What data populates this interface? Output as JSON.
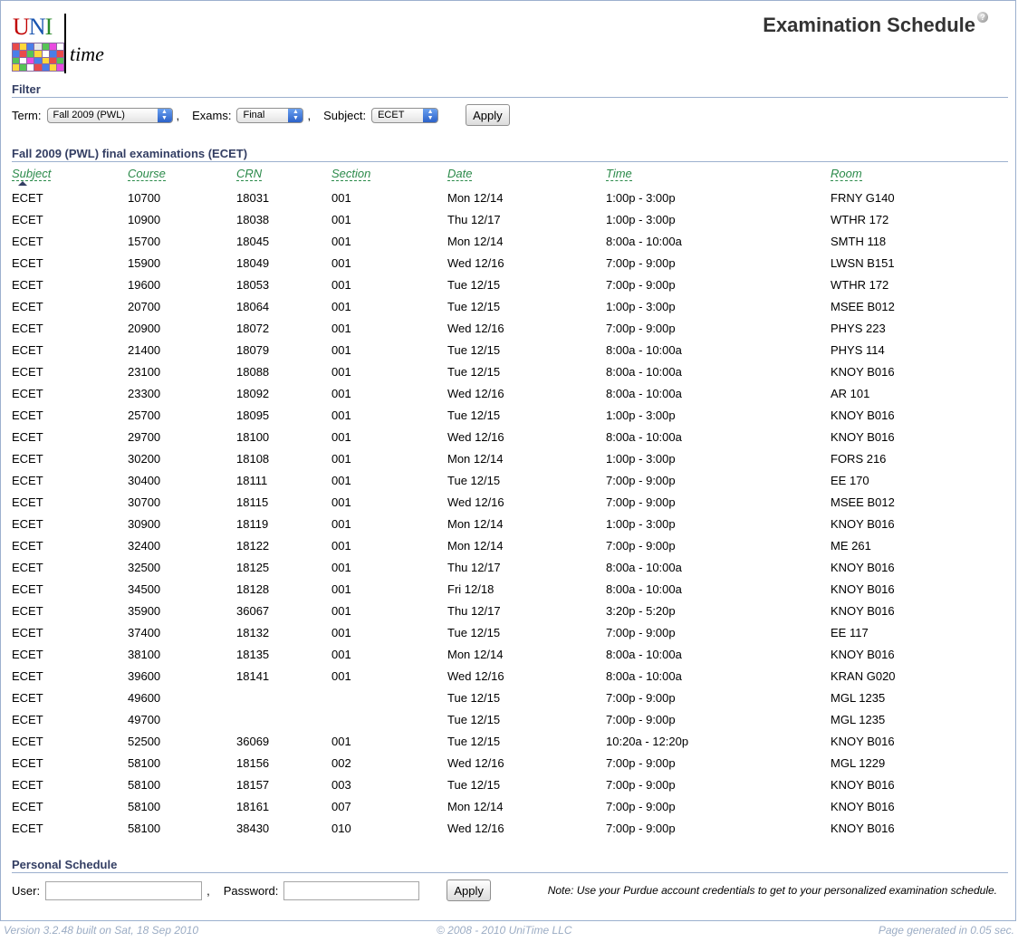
{
  "app": {
    "logo_text": "UNItime",
    "page_title": "Examination Schedule",
    "help_icon": "question-icon"
  },
  "filter": {
    "header": "Filter",
    "term_label": "Term:",
    "term_value": "Fall 2009 (PWL)",
    "exams_label": "Exams:",
    "exams_value": "Final",
    "subject_label": "Subject:",
    "subject_value": "ECET",
    "apply_label": "Apply",
    "comma": ","
  },
  "results": {
    "header": "Fall 2009 (PWL) final examinations (ECET)",
    "columns": [
      "Subject",
      "Course",
      "CRN",
      "Section",
      "Date",
      "Time",
      "Room"
    ],
    "sorted_by": "Subject",
    "rows": [
      [
        "ECET",
        "10700",
        "18031",
        "001",
        "Mon 12/14",
        "1:00p - 3:00p",
        "FRNY G140"
      ],
      [
        "ECET",
        "10900",
        "18038",
        "001",
        "Thu 12/17",
        "1:00p - 3:00p",
        "WTHR 172"
      ],
      [
        "ECET",
        "15700",
        "18045",
        "001",
        "Mon 12/14",
        "8:00a - 10:00a",
        "SMTH 118"
      ],
      [
        "ECET",
        "15900",
        "18049",
        "001",
        "Wed 12/16",
        "7:00p - 9:00p",
        "LWSN B151"
      ],
      [
        "ECET",
        "19600",
        "18053",
        "001",
        "Tue 12/15",
        "7:00p - 9:00p",
        "WTHR 172"
      ],
      [
        "ECET",
        "20700",
        "18064",
        "001",
        "Tue 12/15",
        "1:00p - 3:00p",
        "MSEE B012"
      ],
      [
        "ECET",
        "20900",
        "18072",
        "001",
        "Wed 12/16",
        "7:00p - 9:00p",
        "PHYS 223"
      ],
      [
        "ECET",
        "21400",
        "18079",
        "001",
        "Tue 12/15",
        "8:00a - 10:00a",
        "PHYS 114"
      ],
      [
        "ECET",
        "23100",
        "18088",
        "001",
        "Tue 12/15",
        "8:00a - 10:00a",
        "KNOY B016"
      ],
      [
        "ECET",
        "23300",
        "18092",
        "001",
        "Wed 12/16",
        "8:00a - 10:00a",
        "AR 101"
      ],
      [
        "ECET",
        "25700",
        "18095",
        "001",
        "Tue 12/15",
        "1:00p - 3:00p",
        "KNOY B016"
      ],
      [
        "ECET",
        "29700",
        "18100",
        "001",
        "Wed 12/16",
        "8:00a - 10:00a",
        "KNOY B016"
      ],
      [
        "ECET",
        "30200",
        "18108",
        "001",
        "Mon 12/14",
        "1:00p - 3:00p",
        "FORS 216"
      ],
      [
        "ECET",
        "30400",
        "18111",
        "001",
        "Tue 12/15",
        "7:00p - 9:00p",
        "EE 170"
      ],
      [
        "ECET",
        "30700",
        "18115",
        "001",
        "Wed 12/16",
        "7:00p - 9:00p",
        "MSEE B012"
      ],
      [
        "ECET",
        "30900",
        "18119",
        "001",
        "Mon 12/14",
        "1:00p - 3:00p",
        "KNOY B016"
      ],
      [
        "ECET",
        "32400",
        "18122",
        "001",
        "Mon 12/14",
        "7:00p - 9:00p",
        "ME 261"
      ],
      [
        "ECET",
        "32500",
        "18125",
        "001",
        "Thu 12/17",
        "8:00a - 10:00a",
        "KNOY B016"
      ],
      [
        "ECET",
        "34500",
        "18128",
        "001",
        "Fri 12/18",
        "8:00a - 10:00a",
        "KNOY B016"
      ],
      [
        "ECET",
        "35900",
        "36067",
        "001",
        "Thu 12/17",
        "3:20p - 5:20p",
        "KNOY B016"
      ],
      [
        "ECET",
        "37400",
        "18132",
        "001",
        "Tue 12/15",
        "7:00p - 9:00p",
        "EE 117"
      ],
      [
        "ECET",
        "38100",
        "18135",
        "001",
        "Mon 12/14",
        "8:00a - 10:00a",
        "KNOY B016"
      ],
      [
        "ECET",
        "39600",
        "18141",
        "001",
        "Wed 12/16",
        "8:00a - 10:00a",
        "KRAN G020"
      ],
      [
        "ECET",
        "49600",
        "",
        "",
        "Tue 12/15",
        "7:00p - 9:00p",
        "MGL 1235"
      ],
      [
        "ECET",
        "49700",
        "",
        "",
        "Tue 12/15",
        "7:00p - 9:00p",
        "MGL 1235"
      ],
      [
        "ECET",
        "52500",
        "36069",
        "001",
        "Tue 12/15",
        "10:20a - 12:20p",
        "KNOY B016"
      ],
      [
        "ECET",
        "58100",
        "18156",
        "002",
        "Wed 12/16",
        "7:00p - 9:00p",
        "MGL 1229"
      ],
      [
        "ECET",
        "58100",
        "18157",
        "003",
        "Tue 12/15",
        "7:00p - 9:00p",
        "KNOY B016"
      ],
      [
        "ECET",
        "58100",
        "18161",
        "007",
        "Mon 12/14",
        "7:00p - 9:00p",
        "KNOY B016"
      ],
      [
        "ECET",
        "58100",
        "38430",
        "010",
        "Wed 12/16",
        "7:00p - 9:00p",
        "KNOY B016"
      ]
    ]
  },
  "personal": {
    "header": "Personal Schedule",
    "user_label": "User:",
    "user_value": "",
    "password_label": "Password:",
    "password_value": "",
    "apply_label": "Apply",
    "comma": ",",
    "note": "Note: Use your Purdue account credentials to get to your personalized examination schedule."
  },
  "footer": {
    "version": "Version 3.2.48 built on Sat, 18 Sep 2010",
    "copyright": "© 2008 - 2010 UniTime LLC",
    "generated": "Page generated in 0.05 sec."
  }
}
